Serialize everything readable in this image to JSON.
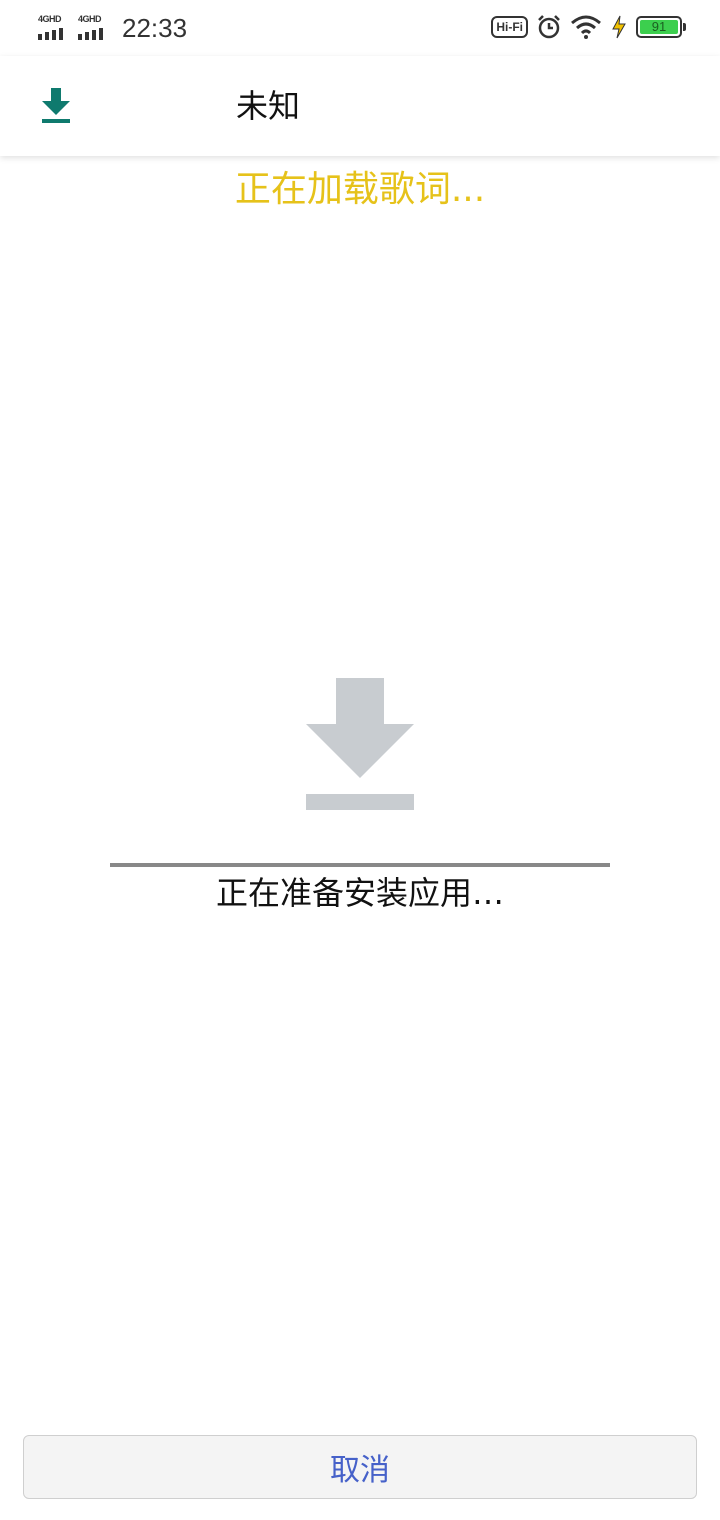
{
  "status_bar": {
    "sim1_label": "4GHD",
    "sim2_label": "4GHD",
    "time": "22:33",
    "hifi_label": "Hi-Fi",
    "battery_level": "91",
    "icons": [
      "alarm-icon",
      "wifi-icon",
      "charging-icon"
    ]
  },
  "app_bar": {
    "title": "未知",
    "icon": "download-icon",
    "icon_color": "#0f7a6e"
  },
  "lyrics_status": "正在加载歌词...",
  "install": {
    "icon": "download-icon",
    "icon_color": "#c8ccd0",
    "progress": 1.0,
    "status_text": "正在准备安装应用…"
  },
  "cancel_label": "取消",
  "colors": {
    "lyrics_text": "#e6c21a",
    "cancel_text": "#4661c9"
  }
}
